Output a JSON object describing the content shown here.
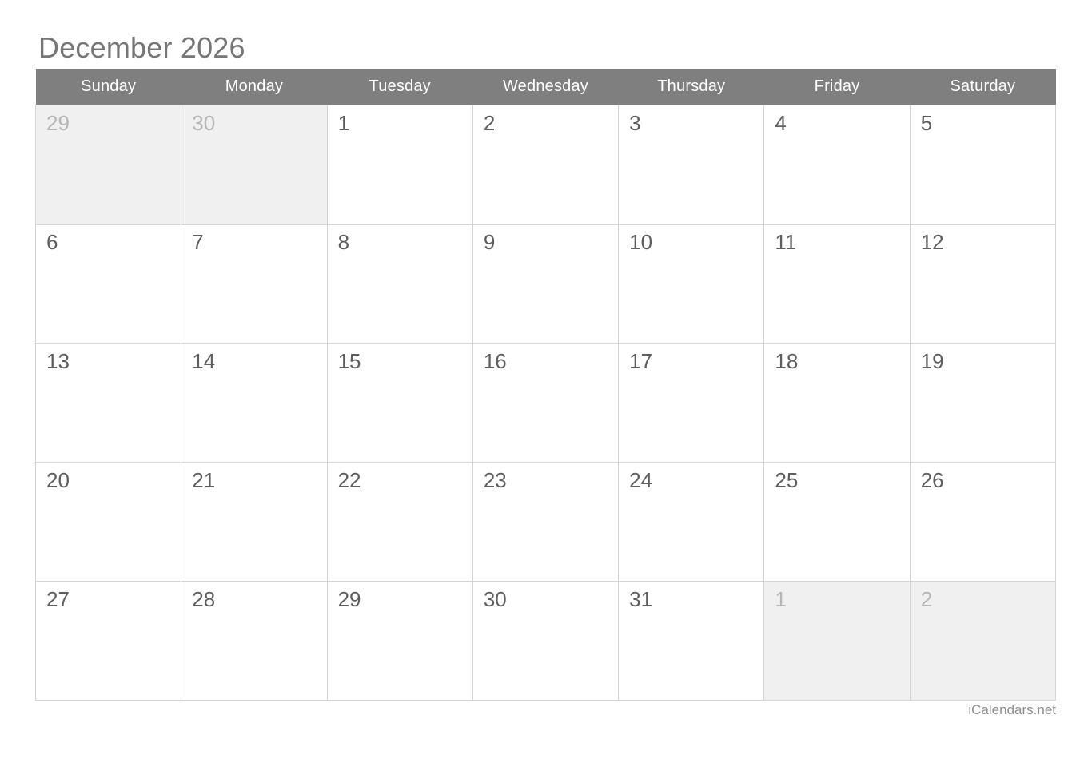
{
  "calendar": {
    "title": "December 2026",
    "month": "December",
    "year": "2026",
    "weekday_headers": [
      "Sunday",
      "Monday",
      "Tuesday",
      "Wednesday",
      "Thursday",
      "Friday",
      "Saturday"
    ],
    "weeks": [
      [
        {
          "day": "29",
          "in_month": false
        },
        {
          "day": "30",
          "in_month": false
        },
        {
          "day": "1",
          "in_month": true
        },
        {
          "day": "2",
          "in_month": true
        },
        {
          "day": "3",
          "in_month": true
        },
        {
          "day": "4",
          "in_month": true
        },
        {
          "day": "5",
          "in_month": true
        }
      ],
      [
        {
          "day": "6",
          "in_month": true
        },
        {
          "day": "7",
          "in_month": true
        },
        {
          "day": "8",
          "in_month": true
        },
        {
          "day": "9",
          "in_month": true
        },
        {
          "day": "10",
          "in_month": true
        },
        {
          "day": "11",
          "in_month": true
        },
        {
          "day": "12",
          "in_month": true
        }
      ],
      [
        {
          "day": "13",
          "in_month": true
        },
        {
          "day": "14",
          "in_month": true
        },
        {
          "day": "15",
          "in_month": true
        },
        {
          "day": "16",
          "in_month": true
        },
        {
          "day": "17",
          "in_month": true
        },
        {
          "day": "18",
          "in_month": true
        },
        {
          "day": "19",
          "in_month": true
        }
      ],
      [
        {
          "day": "20",
          "in_month": true
        },
        {
          "day": "21",
          "in_month": true
        },
        {
          "day": "22",
          "in_month": true
        },
        {
          "day": "23",
          "in_month": true
        },
        {
          "day": "24",
          "in_month": true
        },
        {
          "day": "25",
          "in_month": true
        },
        {
          "day": "26",
          "in_month": true
        }
      ],
      [
        {
          "day": "27",
          "in_month": true
        },
        {
          "day": "28",
          "in_month": true
        },
        {
          "day": "29",
          "in_month": true
        },
        {
          "day": "30",
          "in_month": true
        },
        {
          "day": "31",
          "in_month": true
        },
        {
          "day": "1",
          "in_month": false
        },
        {
          "day": "2",
          "in_month": false
        }
      ]
    ],
    "footer_credit": "iCalendars.net",
    "colors": {
      "header_background": "#7f7f7f",
      "header_text": "#ffffff",
      "title_text": "#767676",
      "day_text": "#5e5e5e",
      "other_month_day_text": "#b6b6b6",
      "other_month_background": "#f0f0f0",
      "cell_border": "#d4d4d4",
      "footer_text": "#8d8d8d",
      "page_background": "#ffffff"
    }
  }
}
